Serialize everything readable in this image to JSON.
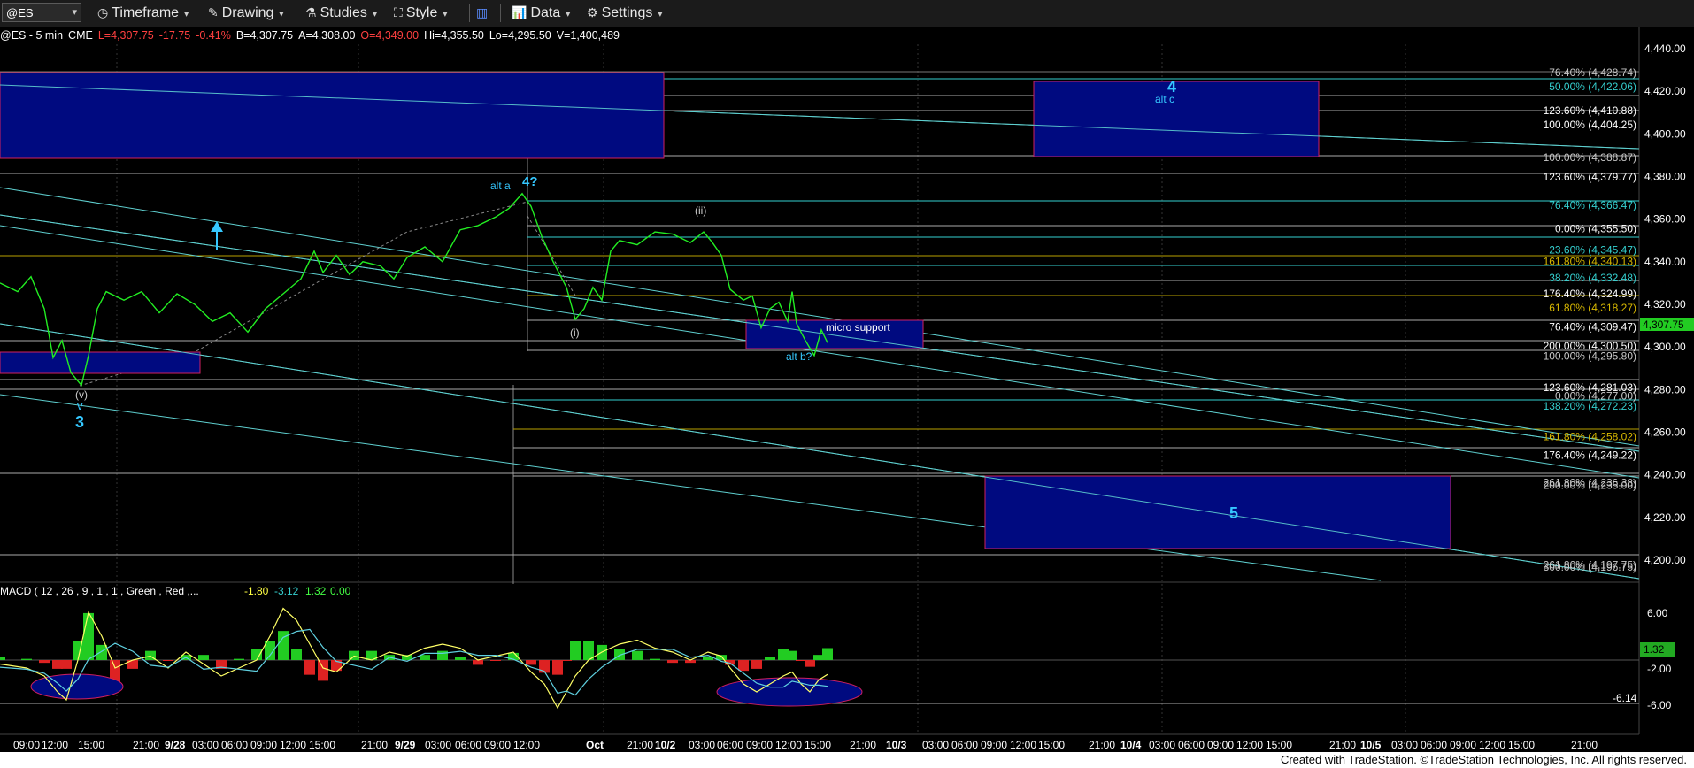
{
  "toolbar": {
    "symbol": "@ES",
    "timeframe": "Timeframe",
    "drawing": "Drawing",
    "studies": "Studies",
    "style": "Style",
    "data": "Data",
    "settings": "Settings"
  },
  "quote": {
    "symbol": "@ES - 5 min",
    "exchange": "CME",
    "last": "L=4,307.75",
    "change": "-17.75",
    "pct": "-0.41%",
    "bid": "B=4,307.75",
    "ask": "A=4,308.00",
    "open": "O=4,349.00",
    "high": "Hi=4,355.50",
    "low": "Lo=4,295.50",
    "volume": "V=1,400,489"
  },
  "price_axis": {
    "ticks": [
      "4,440.00",
      "4,420.00",
      "4,400.00",
      "4,380.00",
      "4,360.00",
      "4,340.00",
      "4,320.00",
      "4,300.00",
      "4,280.00",
      "4,260.00",
      "4,240.00",
      "4,220.00",
      "4,200.00"
    ],
    "last_price": "4,307.75"
  },
  "fib_labels": [
    {
      "text": "76.40% (4,428.74)",
      "color": "#c8c8c8"
    },
    {
      "text": "50.00% (4,422.06)",
      "color": "#35d0d0"
    },
    {
      "text": "123.60% (4,410.88)",
      "color": "#ffffff"
    },
    {
      "text": "100.00% (4,404.25)",
      "color": "#ffffff"
    },
    {
      "text": "100.00% (4,388.87)",
      "color": "#c8c8c8"
    },
    {
      "text": "123.60% (4,379.77)",
      "color": "#ffffff"
    },
    {
      "text": "76.40% (4,366.47)",
      "color": "#35d0d0"
    },
    {
      "text": "0.00% (4,355.50)",
      "color": "#ffffff"
    },
    {
      "text": "23.60% (4,345.47)",
      "color": "#35d0d0"
    },
    {
      "text": "161.80% (4,340.13)",
      "color": "#d8b800"
    },
    {
      "text": "38.20% (4,332.48)",
      "color": "#35d0d0"
    },
    {
      "text": "176.40% (4,324.99)",
      "color": "#ffffff"
    },
    {
      "text": "61.80% (4,318.27)",
      "color": "#d8b800"
    },
    {
      "text": "76.40% (4,309.47)",
      "color": "#ffffff"
    },
    {
      "text": "200.00% (4,300.50)",
      "color": "#ffffff"
    },
    {
      "text": "100.00% (4,295.80)",
      "color": "#c8c8c8"
    },
    {
      "text": "123.60% (4,281.03)",
      "color": "#ffffff"
    },
    {
      "text": "0.00% (4,277.00)",
      "color": "#c8c8c8"
    },
    {
      "text": "138.20% (4,272.23)",
      "color": "#35d0d0"
    },
    {
      "text": "161.80% (4,258.02)",
      "color": "#d8b800"
    },
    {
      "text": "176.40% (4,249.22)",
      "color": "#ffffff"
    },
    {
      "text": "261.80% (4,236.38)",
      "color": "#c8c8c8"
    },
    {
      "text": "200.00% (4,235.00)",
      "color": "#c8c8c8"
    },
    {
      "text": "261.80% (4,197.75)",
      "color": "#c8c8c8"
    },
    {
      "text": "300.00% (4,196.75)",
      "color": "#c8c8c8"
    }
  ],
  "annotations": {
    "wave4_top": "4",
    "alt_c": "alt c",
    "alt_a": "alt a",
    "wave4q": "4?",
    "wave_ii": "(ii)",
    "wave_i": "(i)",
    "micro_support": "micro support",
    "alt_b": "alt b?",
    "wave_v_small": "(v)",
    "wave_v": "v",
    "wave3": "3",
    "wave5": "5"
  },
  "macd": {
    "title": "MACD ( 12 , 26 , 9 , 1 , 1 , Green , Red ,...",
    "v1": "-1.80",
    "v2": "-3.12",
    "v3": "1.32",
    "v4": "0.00",
    "axis_ticks": [
      "6.00",
      "-2.00",
      "-6.00"
    ],
    "label_right_top": "1.32",
    "level_label": "-6.14"
  },
  "time_axis": [
    "09:00",
    "12:00",
    "15:00",
    "21:00",
    "9/28",
    "03:00",
    "06:00",
    "09:00",
    "12:00",
    "15:00",
    "21:00",
    "9/29",
    "03:00",
    "06:00",
    "09:00",
    "12:00",
    "Oct",
    "21:00",
    "10/2",
    "03:00",
    "06:00",
    "09:00",
    "12:00",
    "15:00",
    "21:00",
    "10/3",
    "03:00",
    "06:00",
    "09:00",
    "12:00",
    "15:00",
    "21:00",
    "10/4",
    "03:00",
    "06:00",
    "09:00",
    "12:00",
    "15:00",
    "21:00",
    "10/5",
    "03:00",
    "06:00",
    "09:00",
    "12:00",
    "15:00",
    "21:00"
  ],
  "footer": "Created with TradeStation. ©TradeStation Technologies, Inc. All rights reserved.",
  "colors": {
    "price": "#22ee22",
    "box_fill": "#000a80",
    "box_border": "#d02060",
    "channel": "#5fd0d0",
    "label_blue": "#35c8ff"
  }
}
